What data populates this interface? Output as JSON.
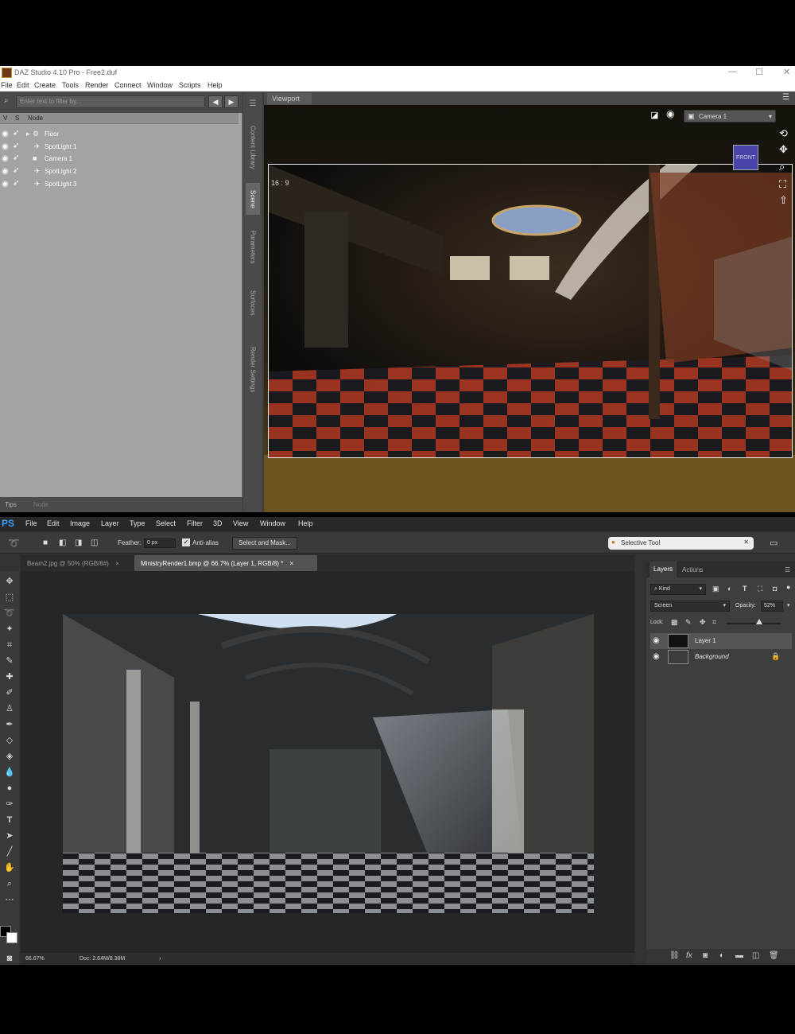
{
  "daz": {
    "title": "DAZ Studio 4.10 Pro - Free2.duf",
    "window_controls": [
      "—",
      "☐",
      "✕"
    ],
    "menu": [
      "File",
      "Edit",
      "Create",
      "Tools",
      "Render",
      "Connect",
      "Window",
      "Scripts",
      "Help"
    ],
    "scene": {
      "filter_placeholder": "Enter text to filter by...",
      "col_v": "V",
      "col_s": "S",
      "col_node": "Node",
      "nodes": [
        {
          "label": "Floor",
          "icon": "figure-icon"
        },
        {
          "label": "SpotLight 1",
          "icon": "spotlight-icon"
        },
        {
          "label": "Camera 1",
          "icon": "camera-icon"
        },
        {
          "label": "SpotLight 2",
          "icon": "spotlight-icon"
        },
        {
          "label": "SpotLight 3",
          "icon": "spotlight-icon"
        }
      ],
      "bottom_tabs": [
        "Tips",
        "Node"
      ]
    },
    "side_tabs": [
      "Content Library",
      "Scene",
      "Parameters",
      "Surfaces",
      "Render Settings"
    ],
    "viewport": {
      "tab_label": "Viewport",
      "aspect": "16 : 9",
      "camera": "Camera 1",
      "cube_label": "FRONT"
    }
  },
  "ps": {
    "logo": "PS",
    "menu": [
      "File",
      "Edit",
      "Image",
      "Layer",
      "Type",
      "Select",
      "Filter",
      "3D",
      "View",
      "Window",
      "Help"
    ],
    "options": {
      "feather_label": "Feather:",
      "feather_value": "0 px",
      "antialias_label": "Anti-alias",
      "select_mask": "Select and Mask...",
      "selective_tool": "Selective Tool"
    },
    "doc_tabs": [
      {
        "label": "Beam2.jpg @ 50% (RGB/8#)",
        "close": "×"
      },
      {
        "label": "MinistryRender1.bmp @ 66.7% (Layer 1, RGB/8) *",
        "close": "×"
      }
    ],
    "status": {
      "zoom": "66.67%",
      "doc": "Doc: 2.64M/8.38M",
      "arrow": "›"
    },
    "layers": {
      "tabs": [
        "Layers",
        "Actions"
      ],
      "kind": "Kind",
      "blend_mode": "Screen",
      "opacity_label": "Opacity:",
      "opacity_value": "52%",
      "lock_label": "Lock:",
      "rows": [
        {
          "name": "Layer 1",
          "selected": true
        },
        {
          "name": "Background",
          "selected": false,
          "locked": true
        }
      ]
    }
  }
}
